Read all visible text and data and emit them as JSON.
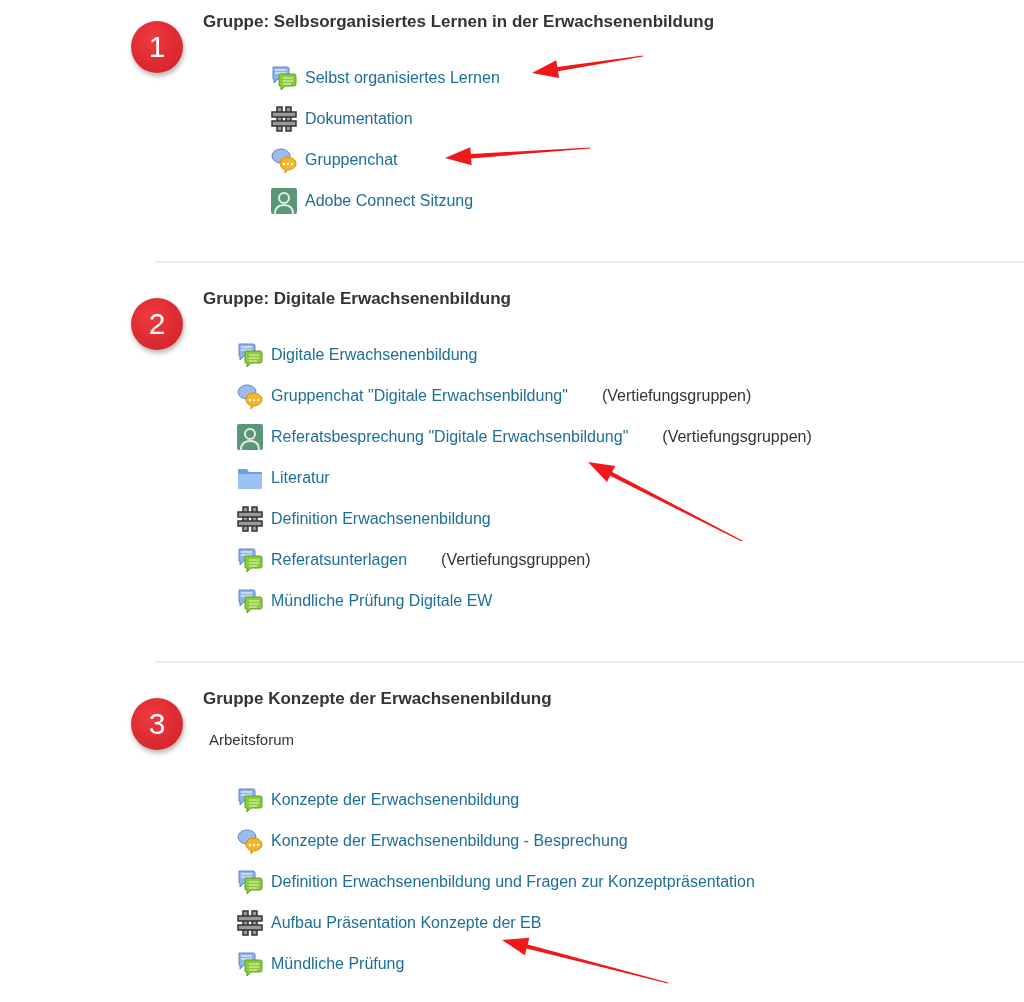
{
  "sections": [
    {
      "number": "1",
      "title": "Gruppe: Selbsorganisiertes Lernen in der Erwachsenenbildung",
      "items": [
        {
          "kind": "forum",
          "label": "Selbst organisiertes Lernen"
        },
        {
          "kind": "wiki",
          "label": "Dokumentation"
        },
        {
          "kind": "chat",
          "label": "Gruppenchat"
        },
        {
          "kind": "connect",
          "label": "Adobe Connect Sitzung"
        }
      ]
    },
    {
      "number": "2",
      "title": "Gruppe: Digitale Erwachsenenbildung",
      "items": [
        {
          "kind": "forum",
          "label": "Digitale Erwachsenenbildung"
        },
        {
          "kind": "chat",
          "label": "Gruppenchat \"Digitale Erwachsenbildung\"",
          "note": "(Vertiefungsgruppen)"
        },
        {
          "kind": "connect",
          "label": "Referatsbesprechung \"Digitale Erwachsenbildung\"",
          "note": "(Vertiefungsgruppen)"
        },
        {
          "kind": "folder",
          "label": "Literatur"
        },
        {
          "kind": "wiki",
          "label": "Definition Erwachsenenbildung"
        },
        {
          "kind": "forum",
          "label": "Referatsunterlagen",
          "note": "(Vertiefungsgruppen)"
        },
        {
          "kind": "forum",
          "label": "Mündliche Prüfung Digitale EW"
        }
      ]
    },
    {
      "number": "3",
      "title": "Gruppe Konzepte der Erwachsenenbildung",
      "description": "Arbeitsforum",
      "items": [
        {
          "kind": "forum",
          "label": "Konzepte der Erwachsenenbildung"
        },
        {
          "kind": "chat",
          "label": "Konzepte der Erwachsenenbildung - Besprechung"
        },
        {
          "kind": "forum",
          "label": "Definition Erwachsenenbildung und Fragen zur Konzeptpräsentation"
        },
        {
          "kind": "wiki",
          "label": "Aufbau Präsentation Konzepte der EB"
        },
        {
          "kind": "forum",
          "label": "Mündliche Prüfung"
        }
      ]
    }
  ]
}
